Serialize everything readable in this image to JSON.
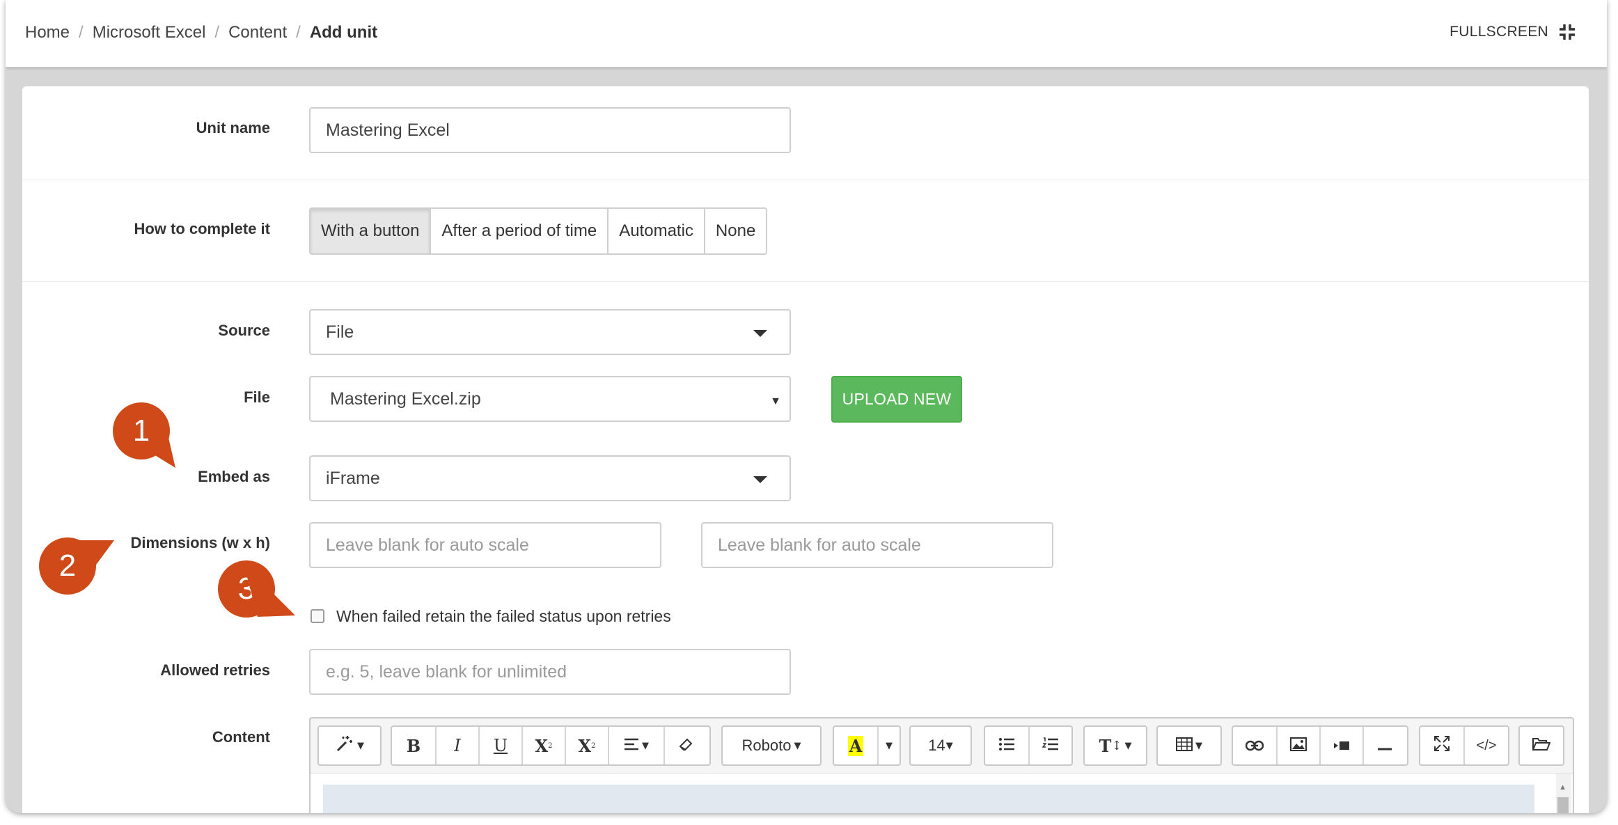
{
  "breadcrumb": {
    "items": [
      "Home",
      "Microsoft Excel",
      "Content"
    ],
    "current": "Add unit",
    "separator": "/"
  },
  "header": {
    "fullscreen_label": "FULLSCREEN",
    "fullscreen_icon": "exit-fullscreen-icon"
  },
  "form": {
    "unit_name": {
      "label": "Unit name",
      "value": "Mastering Excel"
    },
    "completion": {
      "label": "How to complete it",
      "options": [
        "With a button",
        "After a period of time",
        "Automatic",
        "None"
      ],
      "selected": "With a button"
    },
    "source": {
      "label": "Source",
      "value": "File"
    },
    "file": {
      "label": "File",
      "value": "Mastering Excel.zip",
      "upload_label": "UPLOAD NEW"
    },
    "embed_as": {
      "label": "Embed as",
      "value": "iFrame"
    },
    "dimensions": {
      "label": "Dimensions (w x h)",
      "width_placeholder": "Leave blank for auto scale",
      "height_placeholder": "Leave blank for auto scale"
    },
    "retain_failed": {
      "label": "When failed retain the failed status upon retries",
      "checked": false
    },
    "allowed_retries": {
      "label": "Allowed retries",
      "placeholder": "e.g. 5, leave blank for unlimited"
    },
    "content": {
      "label": "Content"
    }
  },
  "editor_toolbar": {
    "font_name": "Roboto",
    "font_size": "14",
    "color_letter": "A",
    "bold": "B",
    "italic": "I",
    "underline": "U",
    "superscript": "X",
    "subscript": "X",
    "style_icon": "T",
    "code_icon": "</>"
  },
  "callouts": [
    "1",
    "2",
    "3"
  ],
  "colors": {
    "callout": "#cf4a18",
    "upload_button": "#5cb85c",
    "highlight_yellow": "#ffff00"
  }
}
